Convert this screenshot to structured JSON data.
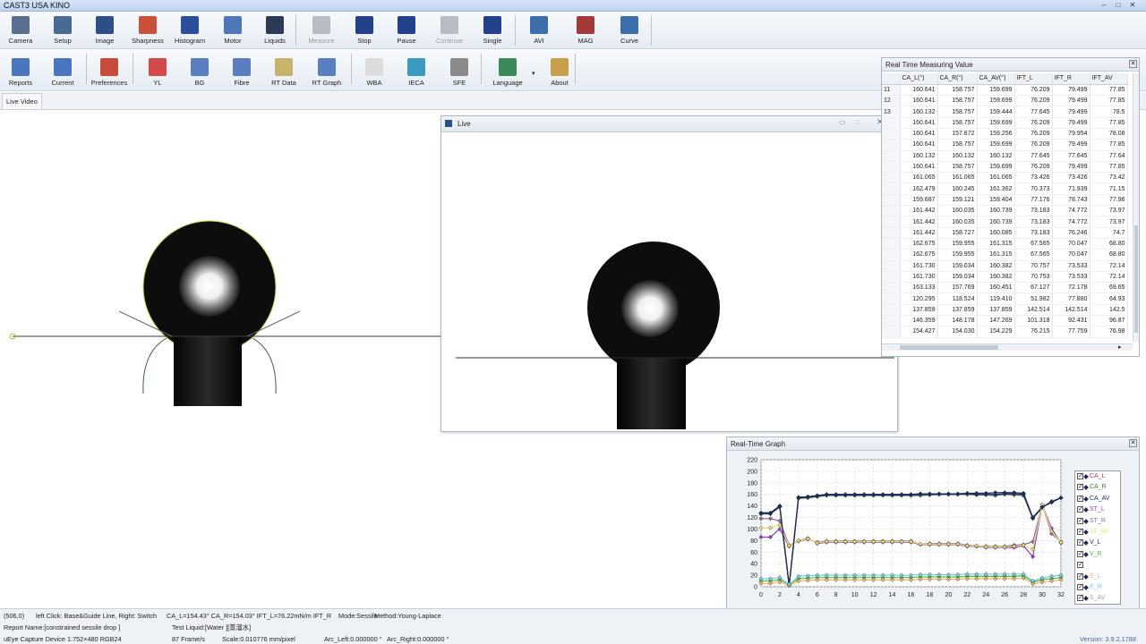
{
  "window": {
    "title": "CAST3  USA KINO"
  },
  "toolbar1": [
    {
      "label": "Camera",
      "icon": "camera-icon",
      "color": "#5a6f8f"
    },
    {
      "label": "Setup",
      "icon": "setup-icon",
      "color": "#4a6a94"
    },
    {
      "label": "Image",
      "icon": "image-icon",
      "color": "#2c4f88"
    },
    {
      "label": "Sharpness",
      "icon": "sharpness-icon",
      "color": "#c9513a"
    },
    {
      "label": "Histogram",
      "icon": "histogram-icon",
      "color": "#2a4f9a"
    },
    {
      "label": "Motor",
      "icon": "motor-icon",
      "color": "#4f78b8"
    },
    {
      "label": "Liquids",
      "icon": "liquids-icon",
      "color": "#2b3a55"
    },
    {
      "label": "Measure",
      "icon": "measure-icon",
      "color": "#b8bcc4",
      "disabled": true
    },
    {
      "label": "Stop",
      "icon": "stop-icon",
      "color": "#23408a"
    },
    {
      "label": "Pause",
      "icon": "pause-icon",
      "color": "#23408a"
    },
    {
      "label": "Continue",
      "icon": "continue-icon",
      "color": "#b8bcc4",
      "disabled": true
    },
    {
      "label": "Single",
      "icon": "single-icon",
      "color": "#23408a"
    },
    {
      "label": "AVI",
      "icon": "avi-icon",
      "color": "#3c6eab"
    },
    {
      "label": "MAG",
      "icon": "mag-icon",
      "color": "#a33a3a"
    },
    {
      "label": "Curve",
      "icon": "curve-icon",
      "color": "#3c6eab"
    }
  ],
  "toolbar2": [
    {
      "label": "Reports",
      "icon": "reports-icon",
      "color": "#4a76c0"
    },
    {
      "label": "Current",
      "icon": "current-icon",
      "color": "#4a76c0"
    },
    {
      "label": "Preferences",
      "icon": "preferences-icon",
      "color": "#c84a3a"
    },
    {
      "label": "YL",
      "icon": "yl-icon",
      "color": "#d24a4a"
    },
    {
      "label": "BG",
      "icon": "bg-icon",
      "color": "#5a7fc0"
    },
    {
      "label": "Fibre",
      "icon": "fibre-icon",
      "color": "#5a7fc0"
    },
    {
      "label": "RT Data",
      "icon": "rt-data-icon",
      "color": "#c9b26a"
    },
    {
      "label": "RT Graph",
      "icon": "rt-graph-icon",
      "color": "#5a7fc0"
    },
    {
      "label": "WBA",
      "icon": "wba-icon",
      "color": "#dcdcdc"
    },
    {
      "label": "IECA",
      "icon": "ieca-icon",
      "color": "#3a9ac0"
    },
    {
      "label": "SFE",
      "icon": "sfe-icon",
      "color": "#8a8a8a"
    },
    {
      "label": "Language",
      "icon": "globe-icon",
      "color": "#3a8a5a"
    },
    {
      "label": "About",
      "icon": "about-icon",
      "color": "#c9a04a"
    }
  ],
  "tabs": {
    "live_video": "Live Video"
  },
  "live_window": {
    "title": "Live"
  },
  "rt_panel": {
    "title": "Real Time Measuring Value",
    "columns": [
      "",
      "CA_L(°)",
      "CA_R(°)",
      "CA_AV(°)",
      "IFT_L",
      "IFT_R",
      "IFT_AV"
    ],
    "rows": [
      [
        "11",
        "160.641",
        "158.757",
        "159.699",
        "76.209",
        "79.499",
        "77.85"
      ],
      [
        "12",
        "160.641",
        "158.757",
        "159.699",
        "76.209",
        "79.499",
        "77.85"
      ],
      [
        "13",
        "160.132",
        "158.757",
        "159.444",
        "77.645",
        "79.499",
        "78.5"
      ],
      [
        "",
        "160.641",
        "158.757",
        "159.699",
        "76.209",
        "79.499",
        "77.85"
      ],
      [
        "",
        "160.641",
        "157.872",
        "159.256",
        "76.209",
        "79.954",
        "78.08"
      ],
      [
        "",
        "160.641",
        "158.757",
        "159.699",
        "76.209",
        "79.499",
        "77.85"
      ],
      [
        "",
        "160.132",
        "160.132",
        "160.132",
        "77.645",
        "77.645",
        "77.64"
      ],
      [
        "",
        "160.641",
        "158.757",
        "159.699",
        "76.209",
        "79.499",
        "77.85"
      ],
      [
        "",
        "161.065",
        "161.065",
        "161.065",
        "73.426",
        "73.426",
        "73.42"
      ],
      [
        "",
        "162.479",
        "160.245",
        "161.362",
        "70.373",
        "71.939",
        "71.15"
      ],
      [
        "",
        "159.687",
        "159.121",
        "159.404",
        "77.176",
        "78.743",
        "77.96"
      ],
      [
        "",
        "161.442",
        "160.035",
        "160.739",
        "73.183",
        "74.772",
        "73.97"
      ],
      [
        "",
        "161.442",
        "160.035",
        "160.739",
        "73.183",
        "74.772",
        "73.97"
      ],
      [
        "",
        "161.442",
        "158.727",
        "160.085",
        "73.183",
        "76.246",
        "74.7"
      ],
      [
        "",
        "162.675",
        "159.955",
        "161.315",
        "67.565",
        "70.047",
        "68.80"
      ],
      [
        "",
        "162.675",
        "159.955",
        "161.315",
        "67.565",
        "70.047",
        "68.80"
      ],
      [
        "",
        "161.730",
        "159.034",
        "160.382",
        "70.757",
        "73.533",
        "72.14"
      ],
      [
        "",
        "161.730",
        "159.034",
        "160.382",
        "70.753",
        "73.533",
        "72.14"
      ],
      [
        "",
        "163.133",
        "157.769",
        "160.451",
        "67.127",
        "72.178",
        "69.65"
      ],
      [
        "",
        "120.295",
        "118.524",
        "119.410",
        "51.982",
        "77.880",
        "64.93"
      ],
      [
        "",
        "137.859",
        "137.859",
        "137.859",
        "142.514",
        "142.514",
        "142.5"
      ],
      [
        "",
        "146.359",
        "148.178",
        "147.269",
        "101.318",
        "92.431",
        "96.87"
      ],
      [
        "",
        "154.427",
        "154.030",
        "154.229",
        "76.215",
        "77.759",
        "76.98"
      ]
    ]
  },
  "graph_panel": {
    "title": "Real-Time Graph",
    "legend": [
      {
        "label": "CA_L",
        "color": "#c0304a",
        "checked": true
      },
      {
        "label": "CA_R",
        "color": "#3a7a3a",
        "checked": true
      },
      {
        "label": "CA_AV",
        "color": "#1a2a8a",
        "checked": true
      },
      {
        "label": "ST_L",
        "color": "#9a3ac0",
        "checked": true
      },
      {
        "label": "ST_R",
        "color": "#8a6a9a",
        "checked": true
      },
      {
        "label": "ST_AV",
        "color": "#e8e070",
        "checked": true
      },
      {
        "label": "V_L",
        "color": "#1a2a5a",
        "checked": true
      },
      {
        "label": "V_R",
        "color": "#4ac040",
        "checked": true
      },
      {
        "label": "",
        "color": "#ffffff",
        "checked": true
      },
      {
        "label": "E_L",
        "color": "#f0b070",
        "checked": true
      },
      {
        "label": "E_R",
        "color": "#7ad0e0",
        "checked": true
      },
      {
        "label": "S_AV",
        "color": "#a0a0a0",
        "checked": true
      }
    ]
  },
  "chart_data": {
    "type": "line",
    "title": "",
    "xlabel": "",
    "ylabel": "",
    "xlim": [
      0,
      32
    ],
    "ylim": [
      0,
      220
    ],
    "x_ticks": [
      0,
      2,
      4,
      6,
      8,
      10,
      12,
      14,
      16,
      18,
      20,
      22,
      24,
      26,
      28,
      30,
      32
    ],
    "y_ticks": [
      0,
      20,
      40,
      60,
      80,
      100,
      120,
      140,
      160,
      180,
      200,
      220
    ],
    "grid": true,
    "legend_position": "right",
    "x": [
      0,
      1,
      2,
      3,
      4,
      5,
      6,
      7,
      8,
      9,
      10,
      11,
      12,
      13,
      14,
      15,
      16,
      17,
      18,
      19,
      20,
      21,
      22,
      23,
      24,
      25,
      26,
      27,
      28,
      29,
      30,
      31,
      32
    ],
    "series": [
      {
        "name": "CA_L",
        "color": "#c0304a",
        "values": [
          128,
          128,
          140,
          2,
          155,
          156,
          158,
          160,
          160,
          160,
          160,
          160,
          160,
          160,
          160,
          160,
          160,
          161,
          161,
          161,
          161,
          161,
          162,
          162,
          162,
          163,
          163,
          163,
          162,
          120,
          138,
          146,
          154
        ]
      },
      {
        "name": "CA_R",
        "color": "#3a7a3a",
        "values": [
          126,
          126,
          138,
          2,
          153,
          154,
          156,
          158,
          158,
          158,
          158,
          158,
          158,
          158,
          158,
          158,
          158,
          158,
          159,
          160,
          160,
          160,
          160,
          159,
          159,
          158,
          160,
          159,
          158,
          118,
          137,
          148,
          154
        ]
      },
      {
        "name": "CA_AV",
        "color": "#1a2a8a",
        "values": [
          127,
          127,
          139,
          2,
          154,
          155,
          157,
          159,
          159,
          159,
          159,
          159,
          159,
          159,
          159,
          159,
          159,
          160,
          160,
          160,
          160,
          160,
          161,
          160,
          160,
          160,
          161,
          161,
          160,
          119,
          138,
          147,
          154
        ]
      },
      {
        "name": "ST_L",
        "color": "#9a3ac0",
        "values": [
          86,
          86,
          100,
          70,
          80,
          84,
          75,
          77,
          77,
          77,
          77,
          77,
          77,
          77,
          77,
          77,
          77,
          73,
          73,
          73,
          73,
          73,
          70,
          70,
          68,
          68,
          68,
          68,
          71,
          52,
          142,
          101,
          76
        ]
      },
      {
        "name": "ST_R",
        "color": "#8a6a9a",
        "values": [
          118,
          118,
          114,
          72,
          79,
          82,
          77,
          79,
          79,
          79,
          79,
          79,
          79,
          79,
          79,
          79,
          79,
          74,
          75,
          75,
          75,
          75,
          72,
          71,
          70,
          70,
          70,
          72,
          73,
          78,
          142,
          92,
          78
        ]
      },
      {
        "name": "ST_AV",
        "color": "#e8e070",
        "values": [
          102,
          102,
          107,
          71,
          80,
          83,
          76,
          78,
          78,
          78,
          78,
          78,
          78,
          78,
          78,
          78,
          78,
          74,
          74,
          74,
          74,
          74,
          71,
          71,
          69,
          69,
          69,
          70,
          72,
          65,
          142,
          96,
          77
        ]
      },
      {
        "name": "V_L",
        "color": "#1a2a5a",
        "values": [
          128,
          128,
          140,
          2,
          155,
          156,
          158,
          160,
          160,
          160,
          160,
          160,
          160,
          160,
          160,
          160,
          160,
          161,
          161,
          161,
          161,
          161,
          162,
          162,
          162,
          163,
          163,
          163,
          162,
          120,
          138,
          146,
          154
        ]
      },
      {
        "name": "V_R",
        "color": "#4ac040",
        "values": [
          10,
          10,
          12,
          4,
          14,
          15,
          16,
          16,
          16,
          16,
          16,
          16,
          16,
          16,
          16,
          16,
          16,
          17,
          17,
          17,
          17,
          17,
          18,
          18,
          18,
          18,
          18,
          18,
          19,
          8,
          12,
          14,
          16
        ]
      },
      {
        "name": "E_L",
        "color": "#f0b070",
        "values": [
          6,
          6,
          8,
          2,
          10,
          11,
          12,
          12,
          12,
          12,
          12,
          12,
          12,
          12,
          12,
          12,
          12,
          13,
          13,
          13,
          13,
          13,
          14,
          14,
          14,
          14,
          14,
          14,
          15,
          5,
          8,
          10,
          12
        ]
      },
      {
        "name": "E_R",
        "color": "#7ad0e0",
        "values": [
          14,
          14,
          16,
          4,
          18,
          19,
          20,
          20,
          20,
          20,
          20,
          20,
          20,
          20,
          20,
          20,
          20,
          21,
          21,
          21,
          21,
          21,
          22,
          22,
          22,
          22,
          22,
          22,
          22,
          10,
          15,
          18,
          20
        ]
      }
    ]
  },
  "statusbar": {
    "coords": "(506,0)",
    "mouse_hint": "left Click: Base&Guide Line, Right: Switch",
    "measure_summary": "CA_L=154.43° CA_R=154.03° IFT_L=76.22mN/m IFT_R",
    "mode": "Mode:Sessile",
    "method": "Method:Young-Laplace",
    "report_name": "Report Name:[constrained sessile drop ]",
    "test_liquid": "Test Liquid:[Water ][蒸溜水]",
    "capture_device": "uEye Capture Device 1:752×480  RGB24",
    "fps": "87  Frame/s",
    "scale": "Scale:0.010776 mm/pixel",
    "arc_left": "Arc_Left:0.000000 °",
    "arc_right": "Arc_Right:0.000000 °",
    "version": "Version:  3.9.2.1788"
  }
}
